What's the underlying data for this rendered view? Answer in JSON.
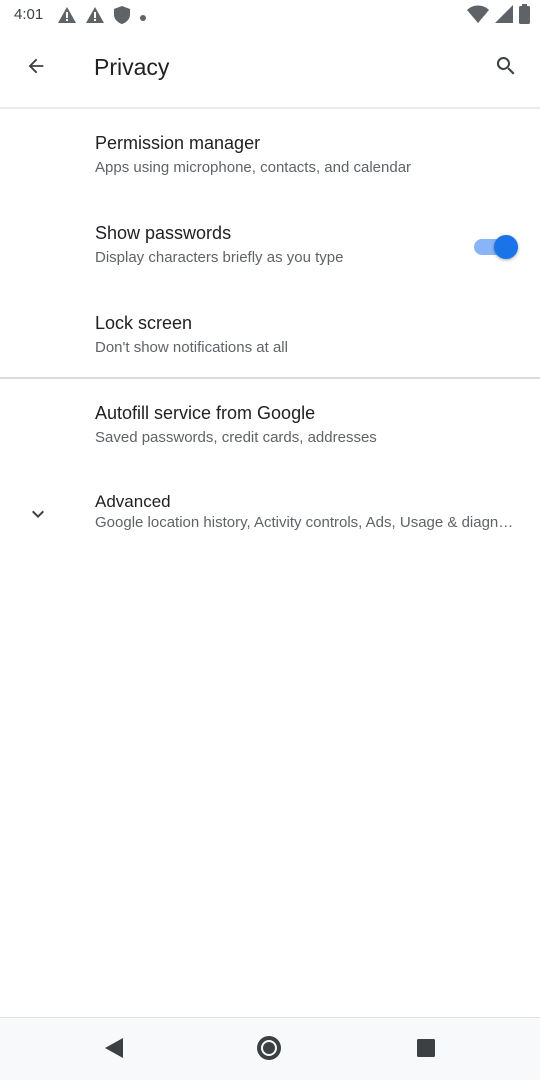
{
  "status_bar": {
    "time": "4:01",
    "left_icons": [
      "warning-icon",
      "warning-icon",
      "shield-icon",
      "dot-icon"
    ],
    "right_icons": [
      "wifi-icon",
      "signal-icon",
      "battery-icon"
    ]
  },
  "app_bar": {
    "title": "Privacy",
    "back_icon": "arrow-back-icon",
    "search_icon": "search-icon"
  },
  "settings": {
    "permission_manager": {
      "title": "Permission manager",
      "summary": "Apps using microphone, contacts, and calendar"
    },
    "show_passwords": {
      "title": "Show passwords",
      "summary": "Display characters briefly as you type",
      "enabled": true
    },
    "lock_screen": {
      "title": "Lock screen",
      "summary": "Don't show notifications at all"
    },
    "autofill": {
      "title": "Autofill service from Google",
      "summary": "Saved passwords, credit cards, addresses"
    },
    "advanced": {
      "title": "Advanced",
      "summary": "Google location history, Activity controls, Ads, Usage & diagnostics",
      "icon": "chevron-down-icon"
    }
  },
  "nav_bar": {
    "icons": [
      "nav-back-icon",
      "nav-home-icon",
      "nav-recents-icon"
    ]
  },
  "colors": {
    "accent": "#1a73e8",
    "accent_track": "#8ab4f8",
    "title_text": "#202124",
    "summary_text": "#5f6368"
  }
}
